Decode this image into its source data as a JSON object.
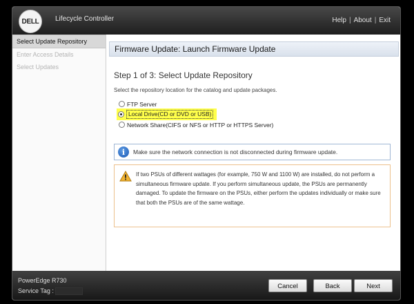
{
  "header": {
    "logo_text": "DELL",
    "app_title": "Lifecycle Controller",
    "links": [
      "Help",
      "About",
      "Exit"
    ],
    "separator": "|"
  },
  "sidebar": {
    "items": [
      {
        "label": "Select Update Repository",
        "active": true
      },
      {
        "label": "Enter Access Details",
        "active": false
      },
      {
        "label": "Select Updates",
        "active": false
      }
    ]
  },
  "main": {
    "banner_title": "Firmware Update: Launch Firmware Update",
    "step_title": "Step 1 of 3: Select Update Repository",
    "instruction": "Select the repository location for the catalog and update packages.",
    "options": [
      {
        "label": "FTP Server",
        "selected": false
      },
      {
        "label": "Local Drive(CD or DVD or USB)",
        "selected": true
      },
      {
        "label": "Network Share(CIFS or NFS or HTTP or HTTPS Server)",
        "selected": false
      }
    ],
    "info_message": "Make sure the network connection is not disconnected during firmware update.",
    "warning_message": "If two PSUs of different wattages (for example, 750 W and 1100 W) are installed, do not perform a simultaneous firmware update. If you perform simultaneous update, the PSUs are permanently damaged. To update the firmware on the PSUs, either perform the updates individually or make sure that both the PSUs are of the same wattage."
  },
  "footer": {
    "model": "PowerEdge R730",
    "service_tag_label": "Service Tag :",
    "buttons": {
      "cancel": "Cancel",
      "back": "Back",
      "next": "Next"
    }
  },
  "colors": {
    "highlight": "#ffff4a",
    "info_border": "#9fb6d4",
    "warning_border": "#ecc08c",
    "header_bg": "#2e2e2e"
  }
}
